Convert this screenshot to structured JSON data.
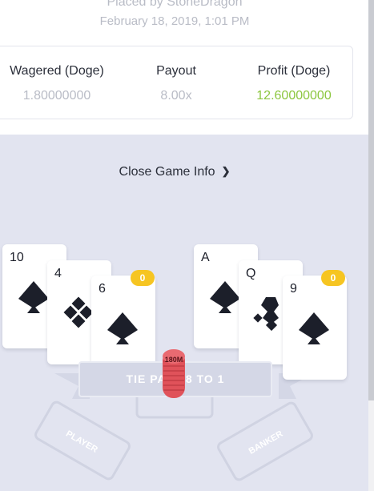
{
  "header": {
    "placed_by": "Placed by StoneDragon",
    "date": "February 18, 2019, 1:01 PM"
  },
  "stats": {
    "wagered_label": "Wagered (Doge)",
    "wagered_value": "1.80000000",
    "payout_label": "Payout",
    "payout_value": "8.00x",
    "profit_label": "Profit (Doge)",
    "profit_value": "12.60000000"
  },
  "game": {
    "toggle_label": "Close Game Info",
    "player_cards": [
      {
        "rank": "10",
        "suit": "spade-icon"
      },
      {
        "rank": "4",
        "suit": "club-icon"
      },
      {
        "rank": "6",
        "suit": "spade-icon"
      }
    ],
    "banker_cards": [
      {
        "rank": "A",
        "suit": "spade-icon"
      },
      {
        "rank": "Q",
        "suit": "club-icon"
      },
      {
        "rank": "9",
        "suit": "spade-icon"
      }
    ],
    "player_score": "0",
    "banker_score": "0",
    "banner_text": "TIE PAYS 8 TO 1",
    "chip_amount": "180M",
    "player_zone": "PLAYER",
    "banker_zone": "BANKER"
  },
  "colors": {
    "profit": "#8cc63f",
    "badge": "#f6c522",
    "chip": "#e0525a",
    "table": "#e2e4f0"
  }
}
